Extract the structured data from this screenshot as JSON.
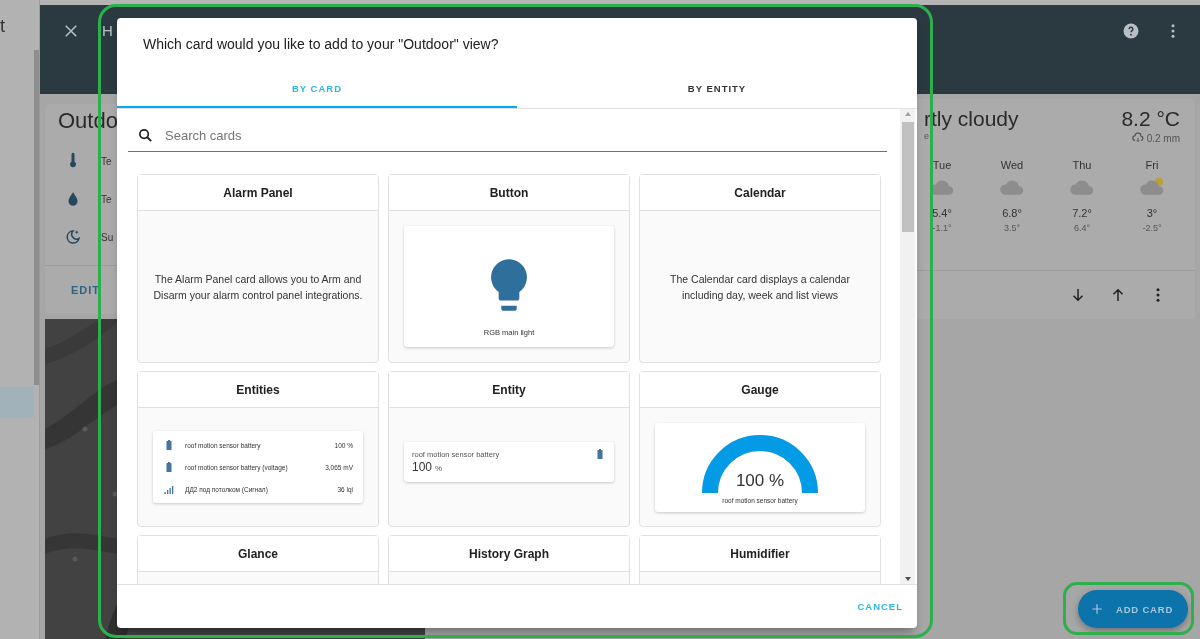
{
  "sidebar": {
    "title_fragment": "t",
    "items": [
      {
        "selected": true
      }
    ]
  },
  "header": {
    "title_fragment": "H"
  },
  "outdoor_card": {
    "title": "Outdo",
    "rows": [
      {
        "label": "Te"
      },
      {
        "label": "Te"
      },
      {
        "label": "Su"
      }
    ],
    "action": "EDIT"
  },
  "weather_card": {
    "condition": "rtly cloudy",
    "subtitle": "e",
    "temperature": "8.2 °C",
    "precipitation": "0.2 mm",
    "forecast": [
      {
        "day": "Tue",
        "kind": "cloudy",
        "high": "5.4°",
        "low": "-1.1°"
      },
      {
        "day": "Wed",
        "kind": "cloudy",
        "high": "6.8°",
        "low": "3.5°"
      },
      {
        "day": "Thu",
        "kind": "cloudy",
        "high": "7.2°",
        "low": "6.4°"
      },
      {
        "day": "Fri",
        "kind": "partly-sunny",
        "high": "3°",
        "low": "-2.5°"
      }
    ]
  },
  "dialog": {
    "title": "Which card would you like to add to your \"Outdoor\" view?",
    "tabs": [
      {
        "label": "BY CARD",
        "selected": true
      },
      {
        "label": "BY ENTITY",
        "selected": false
      }
    ],
    "search": {
      "placeholder": "Search cards"
    },
    "cards": [
      {
        "title": "Alarm Panel",
        "kind": "description",
        "text": "The Alarm Panel card allows you to Arm and Disarm your alarm control panel integrations."
      },
      {
        "title": "Button",
        "kind": "button",
        "entity": "RGB main light"
      },
      {
        "title": "Calendar",
        "kind": "description",
        "text": "The Calendar card displays a calendar including day, week and list views"
      },
      {
        "title": "Entities",
        "kind": "entities",
        "rows": [
          {
            "kind": "battery",
            "name": "roof motion sensor battery",
            "value": "100 %"
          },
          {
            "kind": "battery",
            "name": "roof motion sensor battery (voltage)",
            "value": "3,065 mV"
          },
          {
            "kind": "signal",
            "name": "ДД2 под потолком (Сигнал)",
            "value": "36 lqi"
          }
        ]
      },
      {
        "title": "Entity",
        "kind": "entity",
        "name": "roof motion sensor battery",
        "value": "100",
        "unit": "%"
      },
      {
        "title": "Gauge",
        "kind": "gauge",
        "value": "100 %",
        "name": "roof motion sensor battery",
        "level": 1
      },
      {
        "title": "Glance",
        "kind": "cut"
      },
      {
        "title": "History Graph",
        "kind": "cut"
      },
      {
        "title": "Humidifier",
        "kind": "cut"
      }
    ],
    "buttons": [
      "CANCEL"
    ]
  },
  "fab": {
    "label": "ADD CARD"
  }
}
